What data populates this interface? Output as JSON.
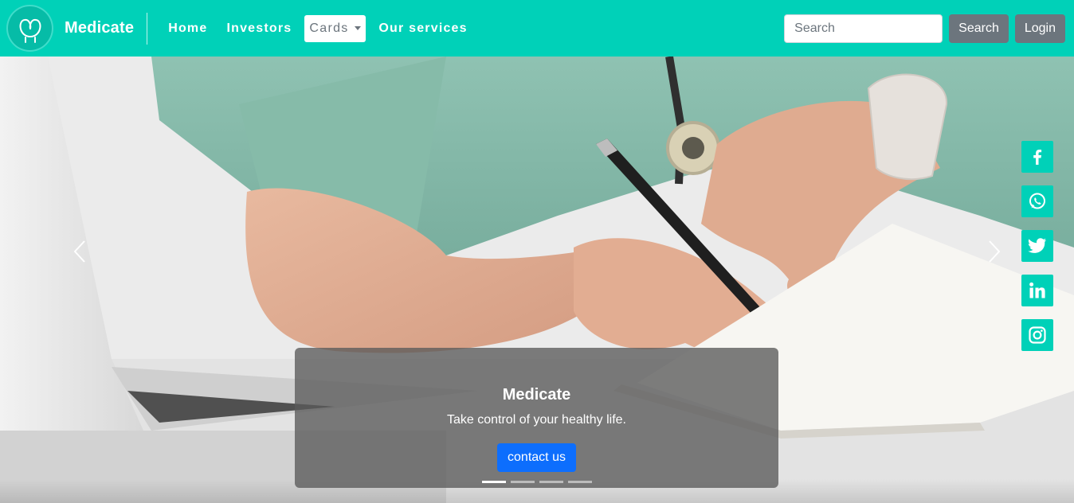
{
  "navbar": {
    "brand": "Medicate",
    "logo_icon": "stethoscope-heart-logo-icon",
    "links": [
      {
        "label": "Home"
      },
      {
        "label": "Investors"
      },
      {
        "label": "Our services"
      }
    ],
    "dropdown": {
      "label": "Cards"
    },
    "search": {
      "placeholder": "Search",
      "value": "",
      "button_label": "Search"
    },
    "login_label": "Login",
    "accent_color": "#00d1b8"
  },
  "carousel": {
    "caption_title": "Medicate",
    "caption_text": "Take control of your healthy life.",
    "cta_label": "contact us",
    "slide_count": 4,
    "active_slide": 1,
    "prev_icon": "chevron-left-icon",
    "next_icon": "chevron-right-icon"
  },
  "social": [
    {
      "name": "facebook",
      "icon": "facebook-icon"
    },
    {
      "name": "whatsapp",
      "icon": "whatsapp-icon"
    },
    {
      "name": "twitter",
      "icon": "twitter-icon"
    },
    {
      "name": "linkedin",
      "icon": "linkedin-icon"
    },
    {
      "name": "instagram",
      "icon": "instagram-icon"
    }
  ]
}
